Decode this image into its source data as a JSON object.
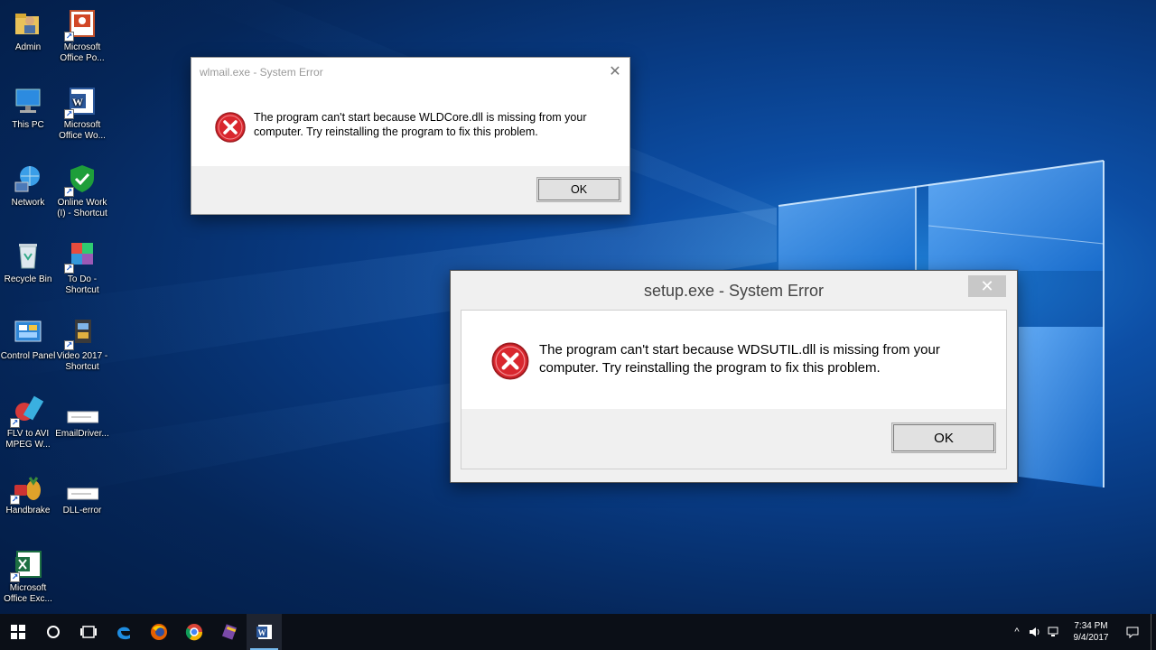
{
  "desktop": {
    "icons": [
      {
        "label": "Admin"
      },
      {
        "label": "Microsoft Office Po..."
      },
      {
        "label": "This PC"
      },
      {
        "label": "Microsoft Office Wo..."
      },
      {
        "label": "Network"
      },
      {
        "label": "Online Work (I) - Shortcut"
      },
      {
        "label": "Recycle Bin"
      },
      {
        "label": "To Do - Shortcut"
      },
      {
        "label": "Control Panel"
      },
      {
        "label": "Video 2017 - Shortcut"
      },
      {
        "label": "FLV to AVI MPEG W..."
      },
      {
        "label": "EmailDriver..."
      },
      {
        "label": "Handbrake"
      },
      {
        "label": "DLL-error"
      },
      {
        "label": "Microsoft Office Exc..."
      }
    ]
  },
  "dialog1": {
    "title": "wlmail.exe - System Error",
    "message": "The program can't start because WLDCore.dll is missing from your computer. Try reinstalling the program to fix this problem.",
    "ok_label": "OK",
    "close_glyph": "✕"
  },
  "dialog2": {
    "title": "setup.exe - System Error",
    "message": "The program can't start because WDSUTIL.dll is missing from your computer. Try reinstalling the program to fix this problem.",
    "ok_label": "OK",
    "close_glyph": "✕"
  },
  "taskbar": {
    "pinned": [
      "start-icon",
      "cortana-icon",
      "task-view-icon",
      "edge-icon",
      "firefox-icon",
      "chrome-icon",
      "winrar-icon",
      "word-icon"
    ],
    "tray_chevron": "^",
    "clock_time": "7:34 PM",
    "clock_date": "9/4/2017"
  },
  "colors": {
    "error_red": "#d9272e",
    "taskbar_bg": "#0b0f17",
    "accent": "#76b9ed"
  }
}
